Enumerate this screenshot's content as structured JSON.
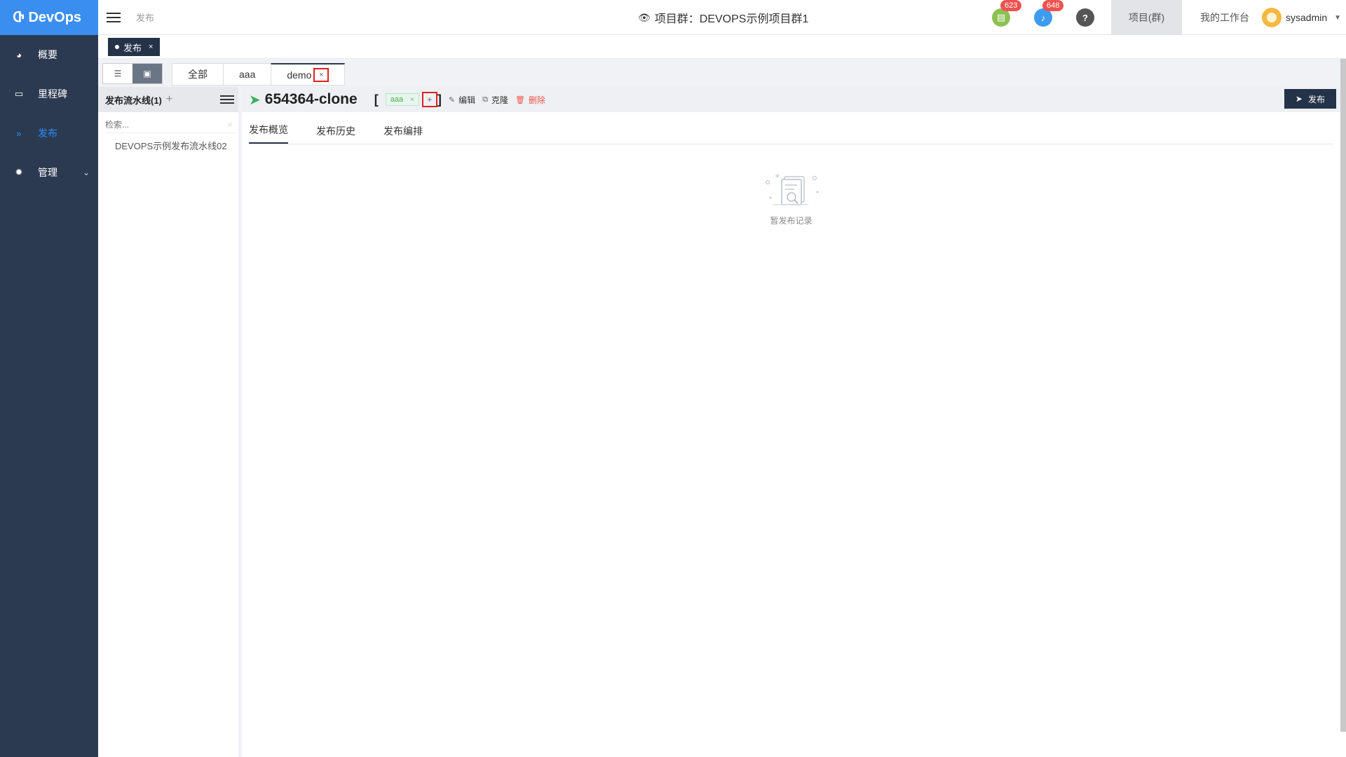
{
  "app": {
    "logo": "DevOps"
  },
  "sidebar": {
    "items": [
      {
        "label": "概要",
        "icon": "dashboard-icon"
      },
      {
        "label": "里程碑",
        "icon": "folder-icon"
      },
      {
        "label": "发布",
        "icon": "forward-icon",
        "active": true
      },
      {
        "label": "管理",
        "icon": "gear-icon"
      }
    ]
  },
  "header": {
    "breadcrumb": "发布",
    "title": "项目群：DEVOPS示例项目群1",
    "todo_count": "623",
    "notify_count": "648",
    "help": "?",
    "nav_project": "项目(群)",
    "nav_workbench": "我的工作台",
    "username": "sysadmin"
  },
  "page_tags": {
    "active": "发布",
    "close": "×"
  },
  "filters": {
    "tabs": [
      "全部",
      "aaa",
      "demo"
    ],
    "close": "×"
  },
  "pipelines": {
    "header": "发布流水线(1)",
    "add": "+",
    "search_placeholder": "检索...",
    "items": [
      "DEVOPS示例发布流水线02"
    ]
  },
  "detail": {
    "title": "654364-clone",
    "bracket_open": "[",
    "bracket_close": "]",
    "tag": "aaa",
    "tag_close": "×",
    "tag_add": "+",
    "edit": "编辑",
    "clone": "克隆",
    "delete": "删除",
    "publish": "发布",
    "tabs": [
      "发布概览",
      "发布历史",
      "发布编排"
    ],
    "empty_text": "暂发布记录"
  },
  "colors": {
    "sidebar_bg": "#2b3a50",
    "logo_bg": "#3a8ef0",
    "active_nav": "#2f8dfb",
    "dark_button": "#253349",
    "badge": "#ef5350",
    "tag_green": "#4caf50",
    "delete_red": "#f0564b"
  }
}
